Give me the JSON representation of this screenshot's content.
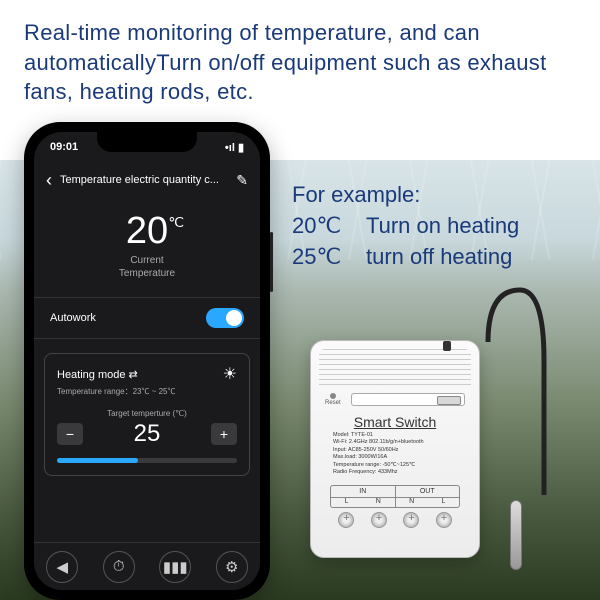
{
  "headline": "Real-time monitoring of temperature, and can automaticallyTurn on/off equipment such as exhaust fans, heating rods, etc.",
  "example": {
    "title": "For example:",
    "line1_temp": "20℃",
    "line1_action": "Turn on heating",
    "line2_temp": "25℃",
    "line2_action": "turn off  heating"
  },
  "phone": {
    "time": "09:01",
    "signal_icons": "•ıl ▮",
    "app_title": "Temperature electric quantity c...",
    "temp_value": "20",
    "temp_unit": "℃",
    "temp_label_l1": "Current",
    "temp_label_l2": "Temperature",
    "autowork_label": "Autowork",
    "autowork_on": true,
    "mode_title": "Heating mode ⇄",
    "range_text": "Temperature range：23℃ ~ 25℃",
    "target_label": "Target temperture (℃)",
    "target_value": "25",
    "minus": "−",
    "plus": "+",
    "nav": [
      "◀",
      "⏱",
      "▮▮▮",
      "⚙"
    ]
  },
  "device": {
    "reset": "Reset",
    "title": "Smart Switch",
    "specs": {
      "model": "Model: TYTE-01",
      "wifi": "Wi-Fi: 2.4GHz 802.11b/g/n+bluetooth",
      "input": "Input: AC85-250V 50/60Hz",
      "maxload": "Max.load: 3000W/16A",
      "temprange": "Temperature range: -50℃~125℃",
      "rf": "Radio Frequency: 433Mhz"
    },
    "in_label": "IN",
    "out_label": "OUT",
    "L": "L",
    "N": "N"
  }
}
